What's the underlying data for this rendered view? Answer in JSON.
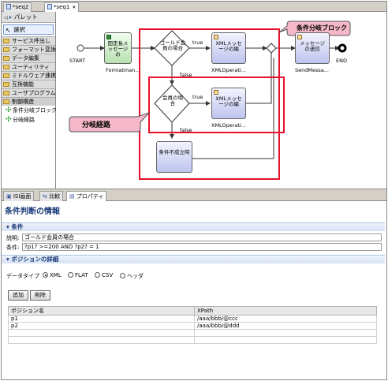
{
  "editor_tabs": [
    {
      "label": "*seq2",
      "active": false
    },
    {
      "label": "*seq1",
      "active": true
    }
  ],
  "palette": {
    "title": "パレット",
    "select_label": "選択",
    "drawers": [
      {
        "label": "サービス呼出し"
      },
      {
        "label": "フォーマット変換"
      },
      {
        "label": "データ編集"
      },
      {
        "label": "ユーティリティ"
      },
      {
        "label": "ミドルウェア連携"
      },
      {
        "label": "互換機能"
      },
      {
        "label": "ユーザプログラム"
      },
      {
        "label": "制御構造"
      }
    ],
    "tools": [
      {
        "label": "条件分岐ブロック"
      },
      {
        "label": "分岐経路"
      }
    ]
  },
  "canvas": {
    "start_label": "START",
    "end_label": "END",
    "node_format_text": "固定長メッセージの",
    "node_format_caption": "Formatman...",
    "gold_cond_text": "ゴールド会員の場合",
    "member_cond_text": "会員の場合",
    "xml1_text": "XMLメッセージの編",
    "xml1_caption": "XMLOperati...",
    "xml2_text": "XMLメッセージの編",
    "xml2_caption": "XMLOperati...",
    "cond_fail_text": "条件不成立時",
    "send_text": "メッセージの送信",
    "send_caption": "SendMessa...",
    "true1": "true",
    "false1": "false",
    "true2": "true",
    "false2": "false",
    "callout_block": "条件分岐ブロック",
    "callout_path": "分岐経路"
  },
  "bottom_tabs": [
    {
      "label": "ISI画面",
      "active": false
    },
    {
      "label": "比較",
      "active": false
    },
    {
      "label": "プロパティ",
      "active": true
    }
  ],
  "properties": {
    "title": "条件判断の情報",
    "section_cond": "条件",
    "desc_label": "説明:",
    "desc_value": "ゴールド会員の場合",
    "cond_label": "条件:",
    "cond_value": "?p1? >=200 AND ?p2? = 1",
    "section_pos": "ポジションの詳細",
    "datatype_label": "データタイプ",
    "datatypes": [
      "XML",
      "FLAT",
      "CSV",
      "ヘッダ"
    ],
    "add_button": "追加",
    "delete_button": "削除",
    "col_position": "ポジション名",
    "col_xpath": "XPath",
    "rows": [
      {
        "name": "p1",
        "xpath": "/aaa/bbb/@ccc"
      },
      {
        "name": "p2",
        "xpath": "/aaa/bbb/@ddd"
      }
    ]
  },
  "colors": {
    "accent_red": "#e8102a",
    "callout_pink": "#f5b8c8",
    "title_blue": "#1a3a7a"
  }
}
